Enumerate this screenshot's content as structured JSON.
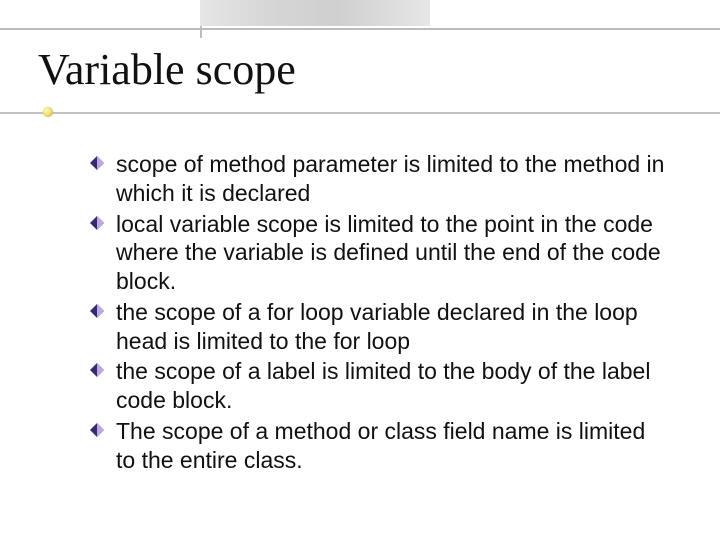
{
  "title": "Variable scope",
  "bullets": [
    "scope of method parameter is limited to the method in which it is declared",
    "local variable scope is limited to the point in the code where the variable is defined until the end of the code block.",
    "the scope of a for loop variable declared in the loop head is limited to the for loop",
    "the scope of a label is limited to the body of the label code block.",
    "The scope of a method or class field name is limited to the entire class."
  ],
  "colors": {
    "bullet_dark": "#3a2a6a",
    "bullet_light": "#b9a7e8"
  }
}
